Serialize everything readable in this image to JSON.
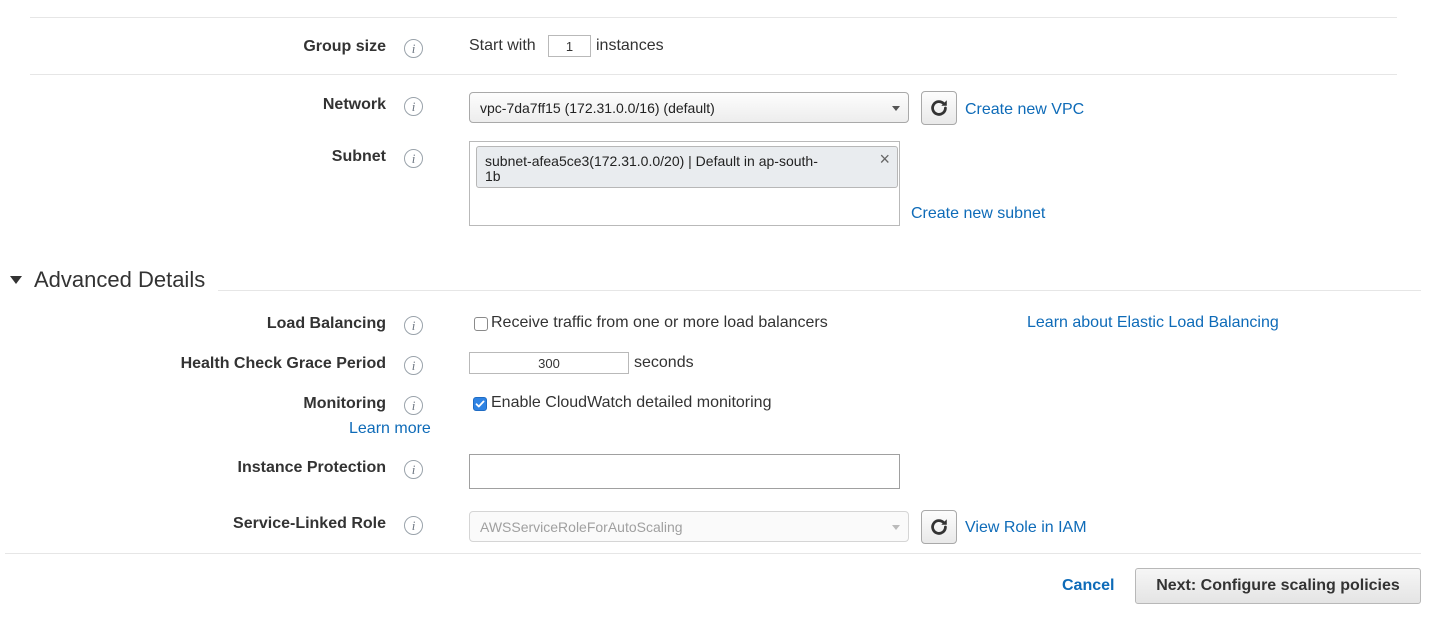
{
  "group_size": {
    "label": "Group size",
    "prefix": "Start with",
    "value": "1",
    "suffix": "instances"
  },
  "network": {
    "label": "Network",
    "selected": "vpc-7da7ff15 (172.31.0.0/16) (default)",
    "create_link": "Create new VPC"
  },
  "subnet": {
    "label": "Subnet",
    "token_line1": "subnet-afea5ce3(172.31.0.0/20) | Default in ap-south-",
    "token_line2": "1b",
    "token_remove": "×",
    "create_link": "Create new subnet"
  },
  "advanced": {
    "title": "Advanced Details"
  },
  "load_balancing": {
    "label": "Load Balancing",
    "checkbox_label": "Receive traffic from one or more load balancers",
    "checked": false,
    "learn_link": "Learn about Elastic Load Balancing"
  },
  "health_check": {
    "label": "Health Check Grace Period",
    "value": "300",
    "unit": "seconds"
  },
  "monitoring": {
    "label": "Monitoring",
    "learn_more": "Learn more",
    "checkbox_label": "Enable CloudWatch detailed monitoring",
    "checked": true
  },
  "instance_protection": {
    "label": "Instance Protection",
    "value": ""
  },
  "service_linked_role": {
    "label": "Service-Linked Role",
    "selected": "AWSServiceRoleForAutoScaling",
    "view_link": "View Role in IAM"
  },
  "footer": {
    "cancel": "Cancel",
    "next": "Next: Configure scaling policies"
  },
  "icons": {
    "info": "i",
    "refresh": "refresh-icon",
    "caret": "caret-down-icon",
    "collapse": "triangle-down-icon",
    "check": "check-icon"
  },
  "colors": {
    "link": "#0e6bb8",
    "checkbox_checked": "#2f83e3"
  }
}
